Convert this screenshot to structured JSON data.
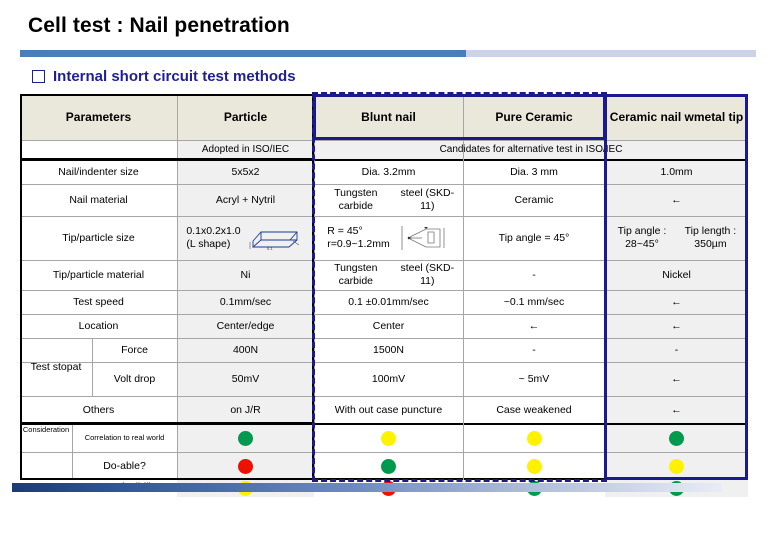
{
  "slide": {
    "title": "Cell test : Nail penetration",
    "subtitle": "Internal short circuit test methods",
    "accent_blue": "#4a7ebb",
    "accent_navy": "#1a1a8c",
    "header_fill": "#eae7db"
  },
  "table": {
    "columns": [
      {
        "key": "param",
        "label": "Parameters"
      },
      {
        "key": "particle",
        "label": "Particle"
      },
      {
        "key": "blunt",
        "label": "Blunt nail"
      },
      {
        "key": "pure",
        "label": "Pure Ceramic"
      },
      {
        "key": "cermet",
        "label": "Ceramic nail w metal tip"
      }
    ],
    "status_row": {
      "particle": "Adopted in ISO/IEC",
      "candidates": "Candidates for alternative test in ISO/IEC"
    },
    "rows": [
      {
        "label": "Nail/indenter size",
        "particle": "5x5x2",
        "blunt": "Dia. 3.2mm",
        "pure": "Dia. 3 mm",
        "cermet": "1.0mm"
      },
      {
        "label": "Nail material",
        "particle": "Acryl + Nytril",
        "blunt": "Tungsten carbide\nsteel (SKD-11)",
        "pure": "Ceramic",
        "cermet": "←"
      },
      {
        "label": "Tip/particle size",
        "particle": "0.1x0.2x1.0\n(L shape)",
        "particle_has_drawing": true,
        "blunt": "R = 45°\nr=0.9~1.2mm",
        "blunt_has_drawing": true,
        "pure": "Tip angle = 45°",
        "cermet": "Tip angle : 28~45°\nTip length : 350µm"
      },
      {
        "label": "Tip/particle material",
        "particle": "Ni",
        "blunt": "Tungsten carbide\nsteel (SKD-11)",
        "pure": "-",
        "cermet": "Nickel"
      },
      {
        "label": "Test speed",
        "particle": "0.1mm/sec",
        "blunt": "0.1 ±0.01mm/sec",
        "pure": "~0.1 mm/sec",
        "cermet": "←"
      },
      {
        "label": "Location",
        "particle": "Center/edge",
        "blunt": "Center",
        "pure": "←",
        "cermet": "←"
      },
      {
        "group": "Test stop at",
        "label": "Force",
        "particle": "400N",
        "blunt": "1500N",
        "pure": "-",
        "cermet": "-"
      },
      {
        "group": "Test stop at",
        "label": "Volt drop",
        "particle": "50mV",
        "blunt": "100mV",
        "pure": "~ 5mV",
        "cermet": "←"
      },
      {
        "label": "Others",
        "particle": "on J/R",
        "blunt": "With out case puncture",
        "pure": "Case weakened",
        "cermet": "←"
      }
    ],
    "consideration": {
      "group_label": "Consider\nation",
      "rows": [
        {
          "label": "Correlation to real world",
          "particle": "green",
          "blunt": "yellow",
          "pure": "yellow",
          "cermet": "green"
        },
        {
          "label": "Do-able?",
          "particle": "red",
          "blunt": "green",
          "pure": "yellow",
          "cermet": "yellow"
        },
        {
          "label": "Reproducibility",
          "particle": "yellow",
          "blunt": "red",
          "pure": "green",
          "cermet": "green"
        }
      ]
    },
    "dot_colors": {
      "green": "#009a4e",
      "red": "#ee1100",
      "yellow": "#fff200"
    }
  }
}
